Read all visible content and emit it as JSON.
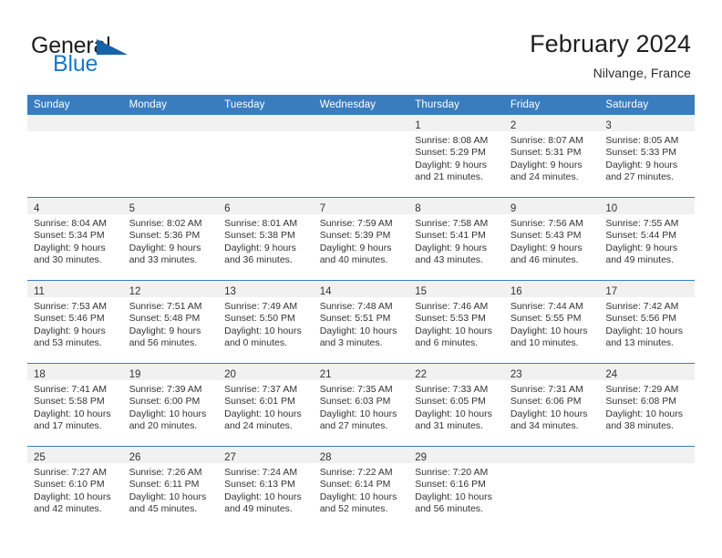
{
  "brand": {
    "word_top": "General",
    "word_bottom": "Blue",
    "triangle_color": "#1763a8",
    "blue_color": "#1b78c8"
  },
  "header": {
    "title": "February 2024",
    "subtitle": "Nilvange, France"
  },
  "theme": {
    "header_blue": "#3a7dbf",
    "band_gray": "#f1f1f1",
    "text": "#333333"
  },
  "weekdays": [
    "Sunday",
    "Monday",
    "Tuesday",
    "Wednesday",
    "Thursday",
    "Friday",
    "Saturday"
  ],
  "weeks": [
    [
      {
        "day": ""
      },
      {
        "day": ""
      },
      {
        "day": ""
      },
      {
        "day": ""
      },
      {
        "day": "1",
        "sunrise": "Sunrise: 8:08 AM",
        "sunset": "Sunset: 5:29 PM",
        "daylight1": "Daylight: 9 hours",
        "daylight2": "and 21 minutes."
      },
      {
        "day": "2",
        "sunrise": "Sunrise: 8:07 AM",
        "sunset": "Sunset: 5:31 PM",
        "daylight1": "Daylight: 9 hours",
        "daylight2": "and 24 minutes."
      },
      {
        "day": "3",
        "sunrise": "Sunrise: 8:05 AM",
        "sunset": "Sunset: 5:33 PM",
        "daylight1": "Daylight: 9 hours",
        "daylight2": "and 27 minutes."
      }
    ],
    [
      {
        "day": "4",
        "sunrise": "Sunrise: 8:04 AM",
        "sunset": "Sunset: 5:34 PM",
        "daylight1": "Daylight: 9 hours",
        "daylight2": "and 30 minutes."
      },
      {
        "day": "5",
        "sunrise": "Sunrise: 8:02 AM",
        "sunset": "Sunset: 5:36 PM",
        "daylight1": "Daylight: 9 hours",
        "daylight2": "and 33 minutes."
      },
      {
        "day": "6",
        "sunrise": "Sunrise: 8:01 AM",
        "sunset": "Sunset: 5:38 PM",
        "daylight1": "Daylight: 9 hours",
        "daylight2": "and 36 minutes."
      },
      {
        "day": "7",
        "sunrise": "Sunrise: 7:59 AM",
        "sunset": "Sunset: 5:39 PM",
        "daylight1": "Daylight: 9 hours",
        "daylight2": "and 40 minutes."
      },
      {
        "day": "8",
        "sunrise": "Sunrise: 7:58 AM",
        "sunset": "Sunset: 5:41 PM",
        "daylight1": "Daylight: 9 hours",
        "daylight2": "and 43 minutes."
      },
      {
        "day": "9",
        "sunrise": "Sunrise: 7:56 AM",
        "sunset": "Sunset: 5:43 PM",
        "daylight1": "Daylight: 9 hours",
        "daylight2": "and 46 minutes."
      },
      {
        "day": "10",
        "sunrise": "Sunrise: 7:55 AM",
        "sunset": "Sunset: 5:44 PM",
        "daylight1": "Daylight: 9 hours",
        "daylight2": "and 49 minutes."
      }
    ],
    [
      {
        "day": "11",
        "sunrise": "Sunrise: 7:53 AM",
        "sunset": "Sunset: 5:46 PM",
        "daylight1": "Daylight: 9 hours",
        "daylight2": "and 53 minutes."
      },
      {
        "day": "12",
        "sunrise": "Sunrise: 7:51 AM",
        "sunset": "Sunset: 5:48 PM",
        "daylight1": "Daylight: 9 hours",
        "daylight2": "and 56 minutes."
      },
      {
        "day": "13",
        "sunrise": "Sunrise: 7:49 AM",
        "sunset": "Sunset: 5:50 PM",
        "daylight1": "Daylight: 10 hours",
        "daylight2": "and 0 minutes."
      },
      {
        "day": "14",
        "sunrise": "Sunrise: 7:48 AM",
        "sunset": "Sunset: 5:51 PM",
        "daylight1": "Daylight: 10 hours",
        "daylight2": "and 3 minutes."
      },
      {
        "day": "15",
        "sunrise": "Sunrise: 7:46 AM",
        "sunset": "Sunset: 5:53 PM",
        "daylight1": "Daylight: 10 hours",
        "daylight2": "and 6 minutes."
      },
      {
        "day": "16",
        "sunrise": "Sunrise: 7:44 AM",
        "sunset": "Sunset: 5:55 PM",
        "daylight1": "Daylight: 10 hours",
        "daylight2": "and 10 minutes."
      },
      {
        "day": "17",
        "sunrise": "Sunrise: 7:42 AM",
        "sunset": "Sunset: 5:56 PM",
        "daylight1": "Daylight: 10 hours",
        "daylight2": "and 13 minutes."
      }
    ],
    [
      {
        "day": "18",
        "sunrise": "Sunrise: 7:41 AM",
        "sunset": "Sunset: 5:58 PM",
        "daylight1": "Daylight: 10 hours",
        "daylight2": "and 17 minutes."
      },
      {
        "day": "19",
        "sunrise": "Sunrise: 7:39 AM",
        "sunset": "Sunset: 6:00 PM",
        "daylight1": "Daylight: 10 hours",
        "daylight2": "and 20 minutes."
      },
      {
        "day": "20",
        "sunrise": "Sunrise: 7:37 AM",
        "sunset": "Sunset: 6:01 PM",
        "daylight1": "Daylight: 10 hours",
        "daylight2": "and 24 minutes."
      },
      {
        "day": "21",
        "sunrise": "Sunrise: 7:35 AM",
        "sunset": "Sunset: 6:03 PM",
        "daylight1": "Daylight: 10 hours",
        "daylight2": "and 27 minutes."
      },
      {
        "day": "22",
        "sunrise": "Sunrise: 7:33 AM",
        "sunset": "Sunset: 6:05 PM",
        "daylight1": "Daylight: 10 hours",
        "daylight2": "and 31 minutes."
      },
      {
        "day": "23",
        "sunrise": "Sunrise: 7:31 AM",
        "sunset": "Sunset: 6:06 PM",
        "daylight1": "Daylight: 10 hours",
        "daylight2": "and 34 minutes."
      },
      {
        "day": "24",
        "sunrise": "Sunrise: 7:29 AM",
        "sunset": "Sunset: 6:08 PM",
        "daylight1": "Daylight: 10 hours",
        "daylight2": "and 38 minutes."
      }
    ],
    [
      {
        "day": "25",
        "sunrise": "Sunrise: 7:27 AM",
        "sunset": "Sunset: 6:10 PM",
        "daylight1": "Daylight: 10 hours",
        "daylight2": "and 42 minutes."
      },
      {
        "day": "26",
        "sunrise": "Sunrise: 7:26 AM",
        "sunset": "Sunset: 6:11 PM",
        "daylight1": "Daylight: 10 hours",
        "daylight2": "and 45 minutes."
      },
      {
        "day": "27",
        "sunrise": "Sunrise: 7:24 AM",
        "sunset": "Sunset: 6:13 PM",
        "daylight1": "Daylight: 10 hours",
        "daylight2": "and 49 minutes."
      },
      {
        "day": "28",
        "sunrise": "Sunrise: 7:22 AM",
        "sunset": "Sunset: 6:14 PM",
        "daylight1": "Daylight: 10 hours",
        "daylight2": "and 52 minutes."
      },
      {
        "day": "29",
        "sunrise": "Sunrise: 7:20 AM",
        "sunset": "Sunset: 6:16 PM",
        "daylight1": "Daylight: 10 hours",
        "daylight2": "and 56 minutes."
      },
      {
        "day": ""
      },
      {
        "day": ""
      }
    ]
  ]
}
